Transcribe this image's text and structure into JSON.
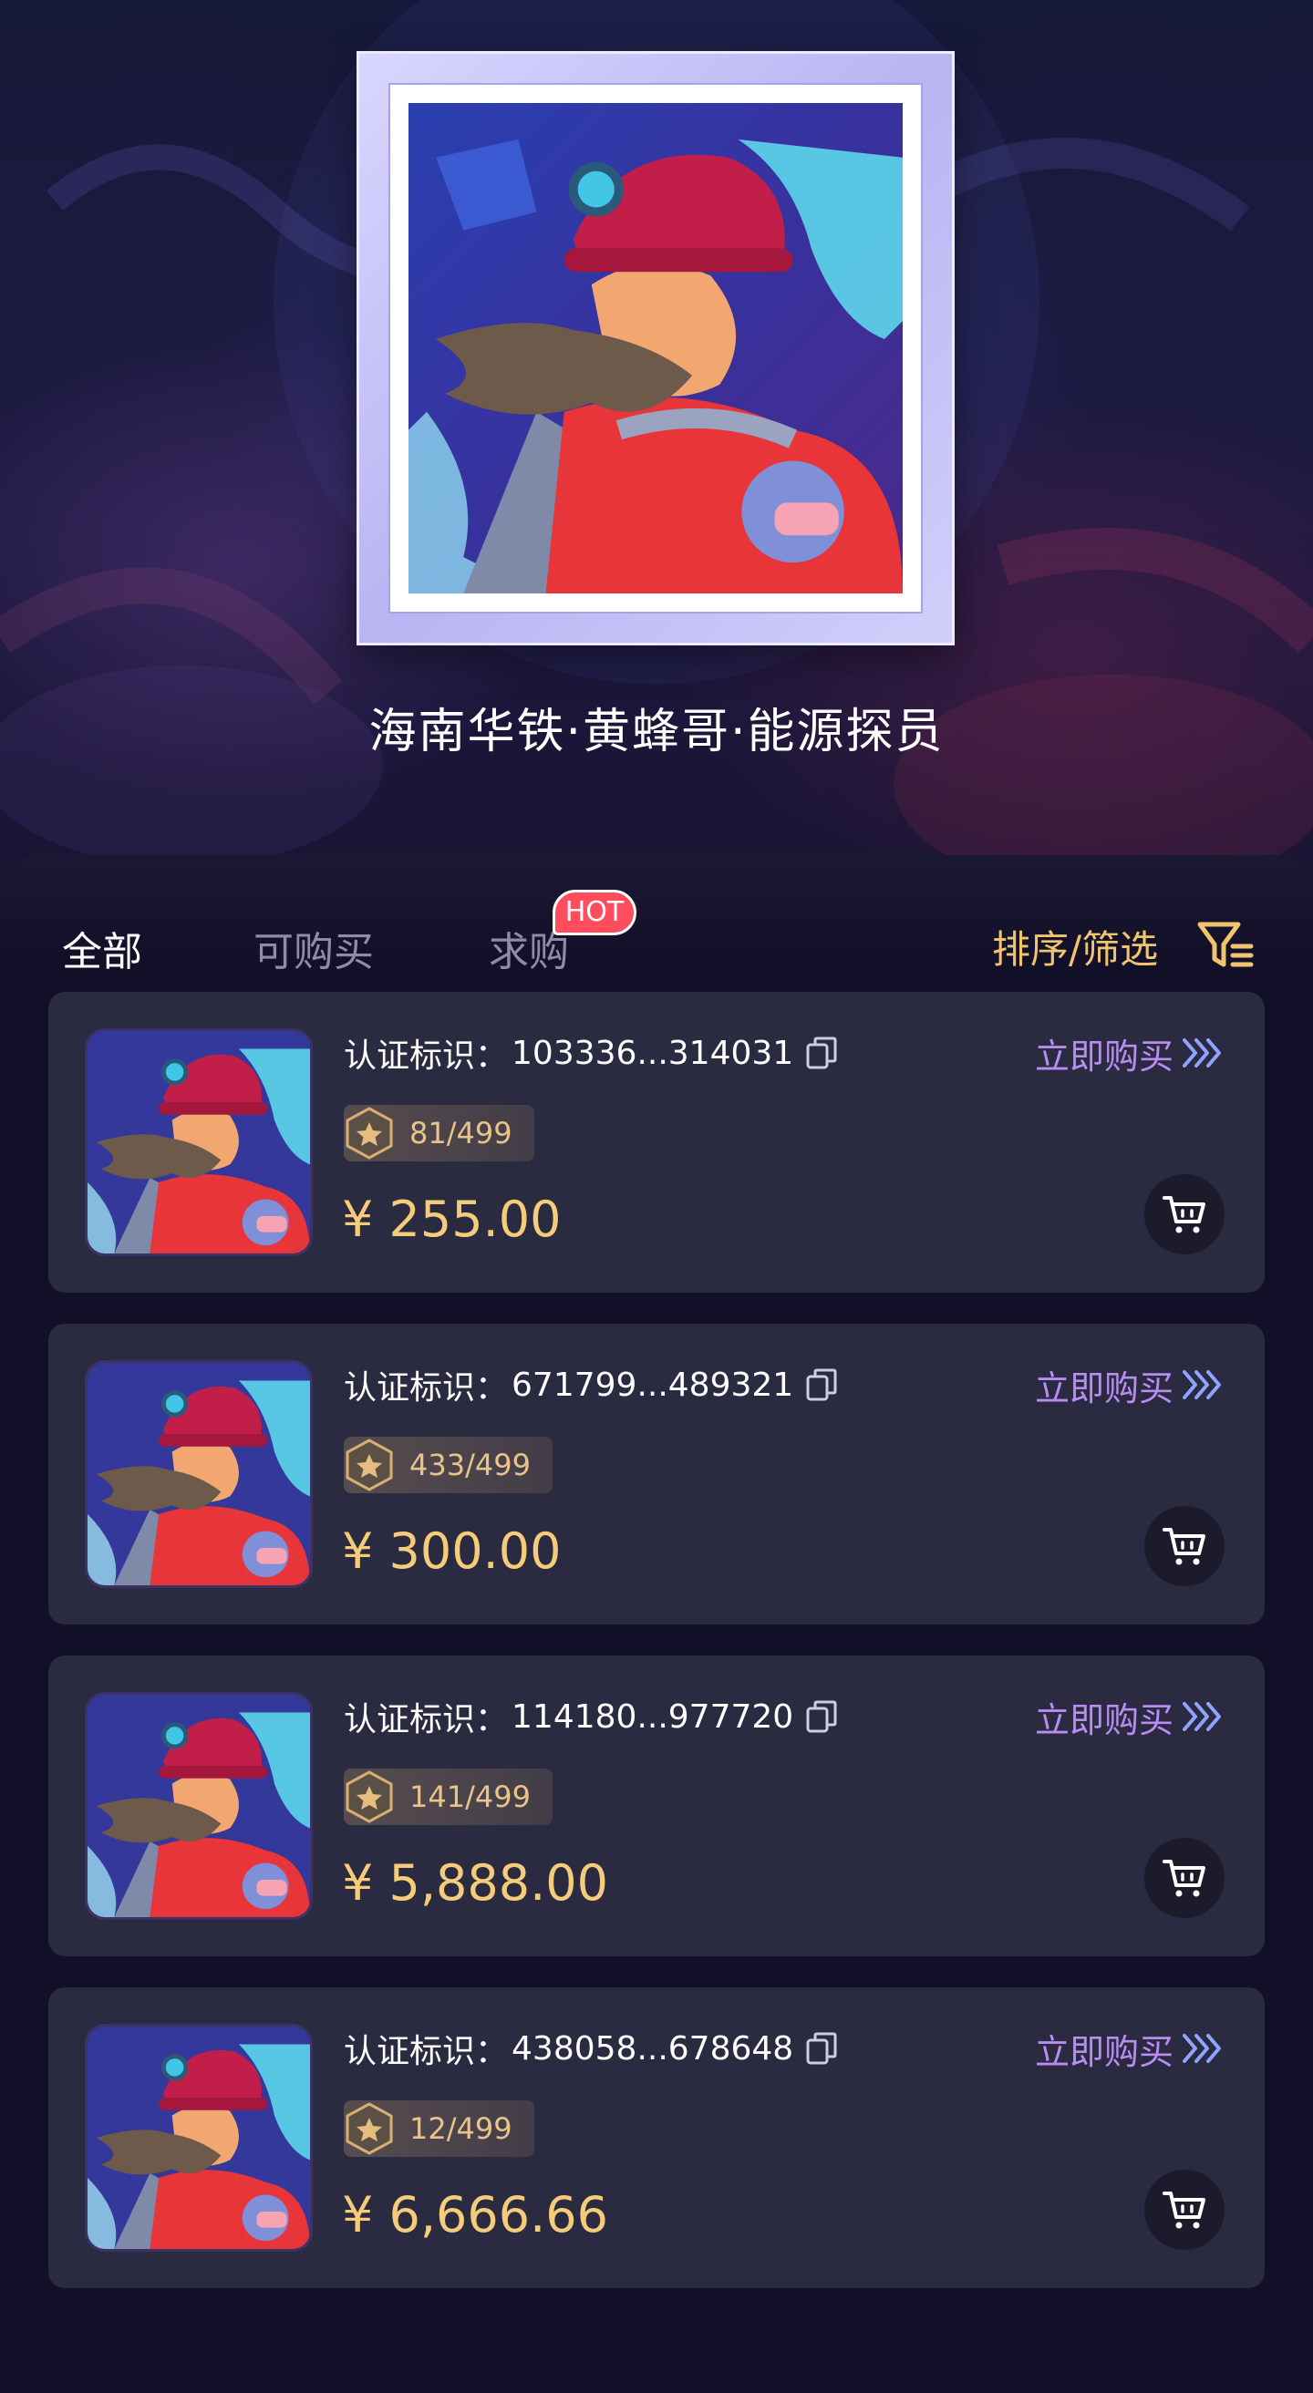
{
  "hero": {
    "title": "海南华铁·黄蜂哥·能源探员"
  },
  "tabs": [
    {
      "label": "全部",
      "active": true
    },
    {
      "label": "可购买",
      "active": false
    },
    {
      "label": "求购",
      "active": false,
      "badge": "HOT"
    }
  ],
  "sort_filter": {
    "label": "排序/筛选",
    "icon": "filter-icon"
  },
  "listings": [
    {
      "cert_label": "认证标识：",
      "cert_id": "103336...314031",
      "edition": "81/499",
      "price": "¥ 255.00",
      "buy_label": "立即购买"
    },
    {
      "cert_label": "认证标识：",
      "cert_id": "671799...489321",
      "edition": "433/499",
      "price": "¥ 300.00",
      "buy_label": "立即购买"
    },
    {
      "cert_label": "认证标识：",
      "cert_id": "114180...977720",
      "edition": "141/499",
      "price": "¥ 5,888.00",
      "buy_label": "立即购买"
    },
    {
      "cert_label": "认证标识：",
      "cert_id": "438058...678648",
      "edition": "12/499",
      "price": "¥ 6,666.66",
      "buy_label": "立即购买"
    }
  ],
  "colors": {
    "background": "#0f0d24",
    "card": "#2a2a40",
    "price": "#f5cc7a",
    "accent_purple": "#b98cf2",
    "sort_gold": "#f1c46e",
    "hot_red": "#ff4d5e"
  }
}
